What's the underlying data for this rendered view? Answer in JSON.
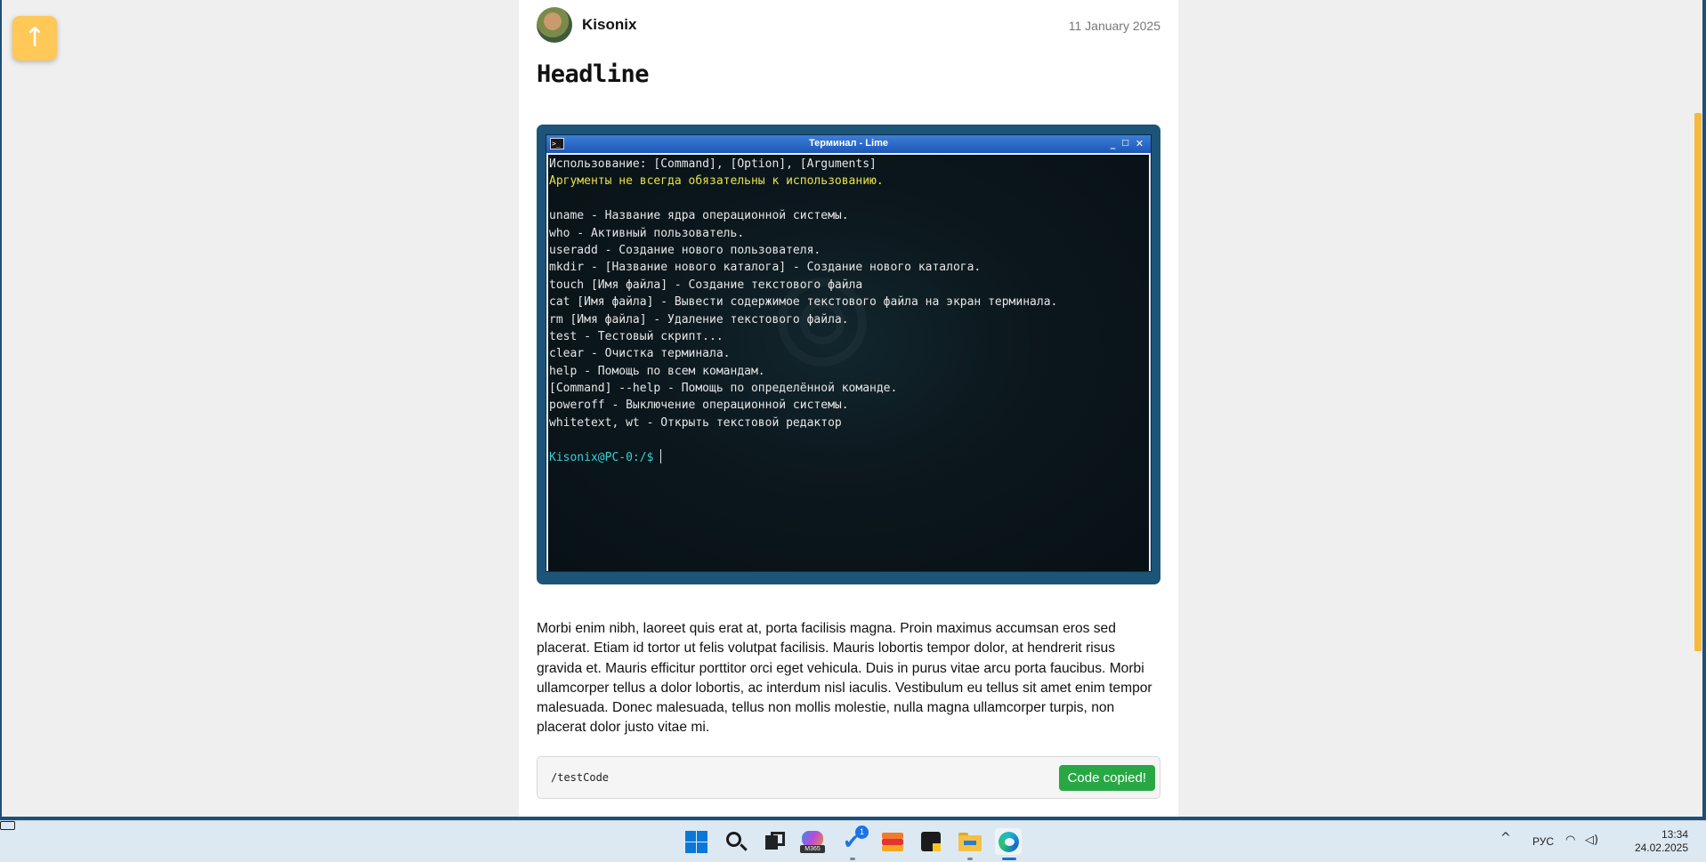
{
  "page": {
    "scroll_top_label": "↑"
  },
  "article": {
    "author": "Kisonix",
    "date": "11 January 2025",
    "headline": "Headline",
    "paragraph": "Morbi enim nibh, laoreet quis erat at, porta facilisis magna. Proin maximus accumsan eros sed placerat. Etiam id tortor ut felis volutpat facilisis. Mauris lobortis tempor dolor, at hendrerit risus gravida et. Mauris efficitur porttitor orci eget vehicula. Duis in purus vitae arcu porta faucibus. Morbi ullamcorper tellus a dolor lobortis, ac interdum nisl iaculis. Vestibulum eu tellus sit amet enim tempor malesuada. Donec malesuada, tellus non mollis molestie, nulla magna ullamcorper turpis, non placerat dolor justo vitae mi.",
    "code": "/testCode",
    "copy_button": "Code copied!"
  },
  "terminal": {
    "title": "Терминал - Lime",
    "lines": [
      "Использование: [Command], [Option], [Arguments]",
      "Аргументы не всегда обязательны к использованию.",
      "",
      "uname - Название ядра операционной системы.",
      "who - Активный пользователь.",
      "useradd - Создание нового пользователя.",
      "mkdir - [Название нового каталога] - Создание нового каталога.",
      "touch [Имя файла] - Создание текстового файла",
      "cat [Имя файла] - Вывести содержимое текстового файла на экран терминала.",
      "rm [Имя файла] - Удаление текстового файла.",
      "test - Тестовый скрипт...",
      "clear - Очистка терминала.",
      "help - Помощь по всем командам.",
      "[Command] --help - Помощь по определённой команде.",
      "poweroff - Выключение операционной системы.",
      "whitetext, wt - Открыть текстовой редактор",
      ""
    ],
    "prompt": "Kisonix@PC-0:/$"
  },
  "taskbar": {
    "m365_tag": "M365",
    "todo_badge": "1",
    "language": "РУС",
    "time": "13:34",
    "date": "24.02.2025"
  },
  "colors": {
    "accent_yellow": "#ffc857",
    "copy_green": "#28a745",
    "terminal_prompt": "#38d0d6",
    "terminal_hint": "#e8e24a"
  }
}
